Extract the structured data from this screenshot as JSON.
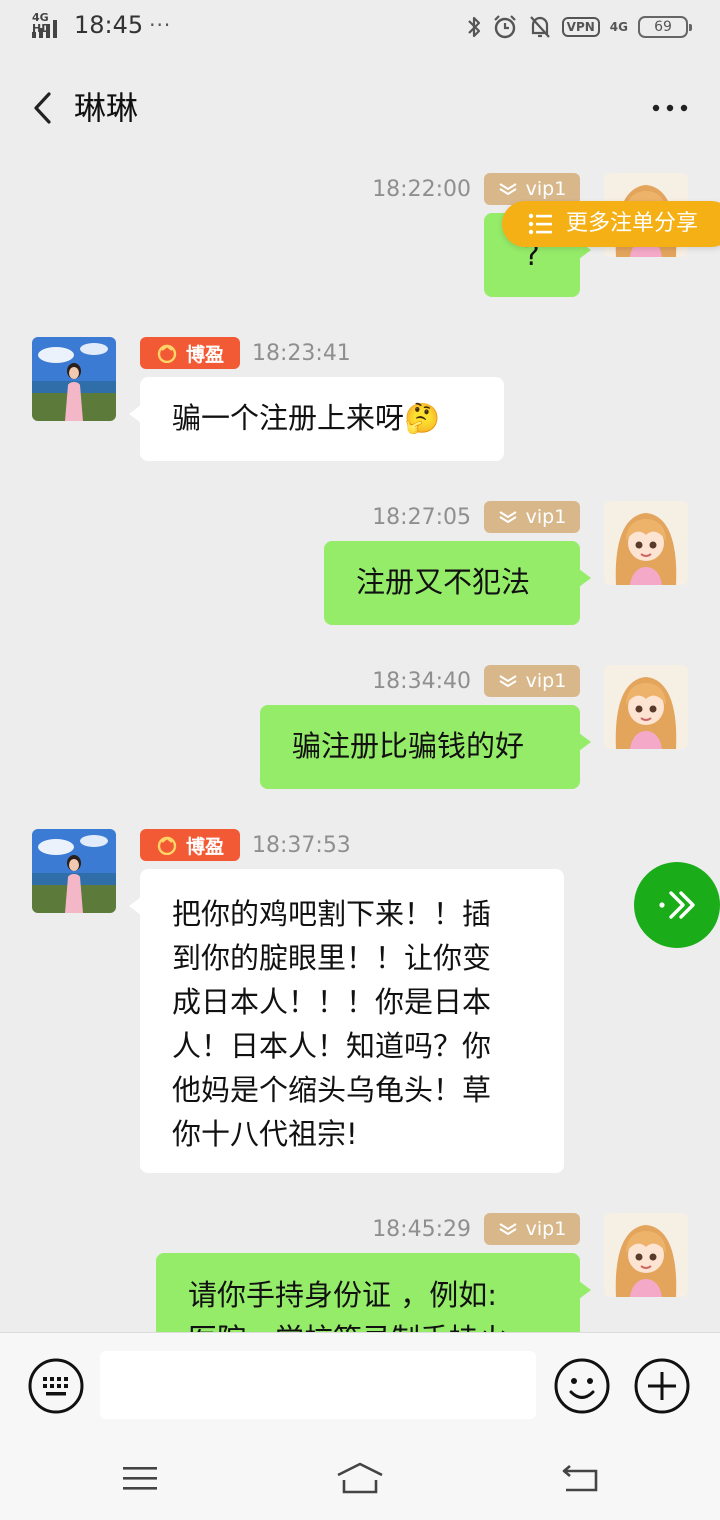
{
  "status_bar": {
    "network": "4G HD",
    "time": "18:45",
    "dots": "···",
    "vpn": "VPN",
    "signal2": "4G",
    "battery": "69"
  },
  "header": {
    "title": "琳琳",
    "back_icon": "chevron-left-icon",
    "more_icon": "more-dots-icon"
  },
  "share_banner": {
    "label": "更多注单分享",
    "icon": "list-icon"
  },
  "tags": {
    "vip": "vip1",
    "bo": "博盈"
  },
  "messages": [
    {
      "sender": "me",
      "time": "18:22:00",
      "text": "?"
    },
    {
      "sender": "other",
      "time": "18:23:41",
      "text": "骗一个注册上来呀🤔"
    },
    {
      "sender": "me",
      "time": "18:27:05",
      "text": "注册又不犯法"
    },
    {
      "sender": "me",
      "time": "18:34:40",
      "text": "骗注册比骗钱的好"
    },
    {
      "sender": "other",
      "time": "18:37:53",
      "lines": [
        "把你的鸡吧割下来！！插",
        "到你的腚眼里！！让你变",
        "成日本人！！！你是日本",
        "人！日本人！知道吗？你",
        "他妈是个缩头乌龟头！草",
        "你十八代祖宗!"
      ]
    },
    {
      "sender": "me",
      "time": "18:45:29",
      "lines": [
        "请你手持身份证 ，例如:",
        "医院，学校等录制手持火"
      ]
    }
  ],
  "input_bar": {
    "keyboard_icon": "keyboard-icon",
    "placeholder": "",
    "emoji_icon": "emoji-icon",
    "add_icon": "plus-circle-icon"
  },
  "floating_button": {
    "icon": "forward-arrow-icon"
  },
  "nav_bar": {
    "menu_icon": "menu-icon",
    "home_icon": "home-icon",
    "back_icon": "back-icon"
  },
  "colors": {
    "background": "#ededed",
    "my_bubble": "#95ec69",
    "other_bubble": "#ffffff",
    "vip_tag": "#d8b78b",
    "bo_tag": "#f25a35",
    "share_banner": "#f5b015",
    "float_button": "#1aad19"
  }
}
